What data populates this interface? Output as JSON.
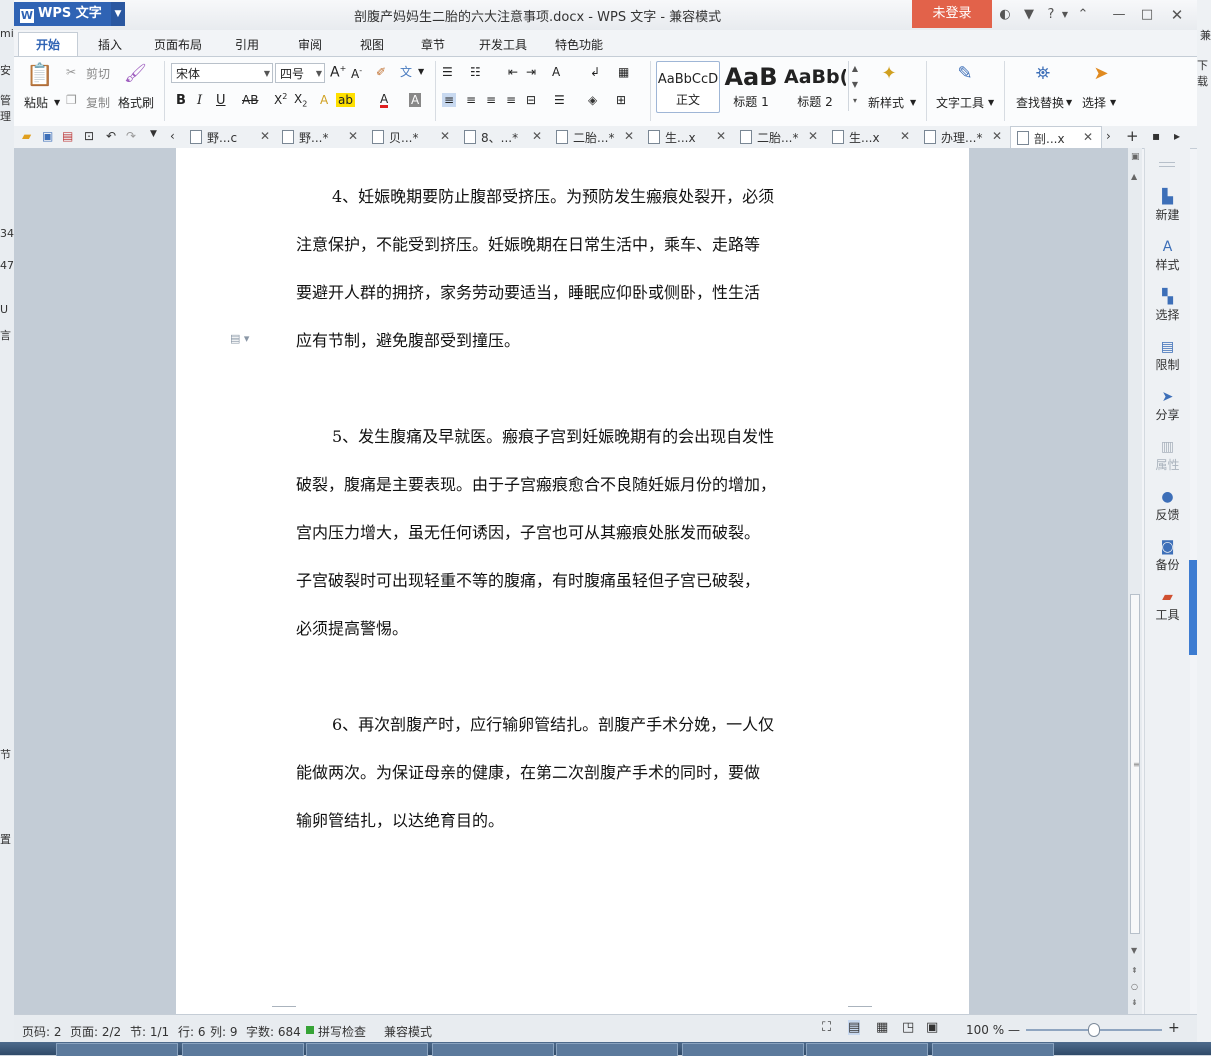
{
  "background_left": [
    "mi",
    "安",
    "管理",
    "34",
    "47",
    "U",
    "言",
    "节",
    "置"
  ],
  "background_right": [
    "下载",
    "兼"
  ],
  "titlebar": {
    "app_name": "WPS 文字",
    "doc_title": "剖腹产妈妈生二胎的六大注意事项.docx - WPS 文字 - 兼容模式",
    "login": "未登录",
    "help": "?"
  },
  "ribbon_tabs": [
    "开始",
    "插入",
    "页面布局",
    "引用",
    "审阅",
    "视图",
    "章节",
    "开发工具",
    "特色功能"
  ],
  "ribbon": {
    "paste": "粘贴",
    "cut": "剪切",
    "copy": "复制",
    "format_painter": "格式刷",
    "font_name": "宋体",
    "font_size": "四号",
    "styles": [
      {
        "preview": "AaBbCcD",
        "name": "正文"
      },
      {
        "preview": "AaB",
        "name": "标题 1"
      },
      {
        "preview": "AaBb(",
        "name": "标题 2"
      }
    ],
    "new_style": "新样式",
    "text_tools": "文字工具",
    "find_replace": "查找替换",
    "select": "选择"
  },
  "doc_tabs": [
    "野...c",
    "野...*",
    "贝...*",
    "8、...*",
    "二胎...*",
    "生...x",
    "二胎...*",
    "生...x",
    "办理...*",
    "剖...x"
  ],
  "document": {
    "paragraphs": [
      {
        "lines": [
          "4、妊娠晚期要防止腹部受挤压。为预防发生瘢痕处裂开，必须",
          "注意保护，不能受到挤压。妊娠晚期在日常生活中，乘车、走路等",
          "要避开人群的拥挤，家务劳动要适当，睡眠应仰卧或侧卧，性生活",
          "应有节制，避免腹部受到撞压。"
        ]
      },
      {
        "lines": [
          "5、发生腹痛及早就医。瘢痕子宫到妊娠晚期有的会出现自发性",
          "破裂，腹痛是主要表现。由于子宫瘢痕愈合不良随妊娠月份的增加，",
          "宫内压力增大，虽无任何诱因，子宫也可从其瘢痕处胀发而破裂。",
          "子宫破裂时可出现轻重不等的腹痛，有时腹痛虽轻但子宫已破裂，",
          "必须提高警惕。"
        ]
      },
      {
        "lines": [
          "6、再次剖腹产时，应行输卵管结扎。剖腹产手术分娩，一人仅",
          "能做两次。为保证母亲的健康，在第二次剖腹产手术的同时，要做",
          "输卵管结扎，以达绝育目的。"
        ]
      }
    ]
  },
  "sidebar": [
    "新建",
    "样式",
    "选择",
    "限制",
    "分享",
    "属性",
    "反馈",
    "备份",
    "工具"
  ],
  "statusbar": {
    "page_code": "页码: 2",
    "pages": "页面: 2/2",
    "section": "节: 1/1",
    "row": "行: 6",
    "col": "列: 9",
    "word_count": "字数: 684",
    "spell_check": "拼写检查",
    "compat_mode": "兼容模式",
    "zoom": "100 %"
  }
}
